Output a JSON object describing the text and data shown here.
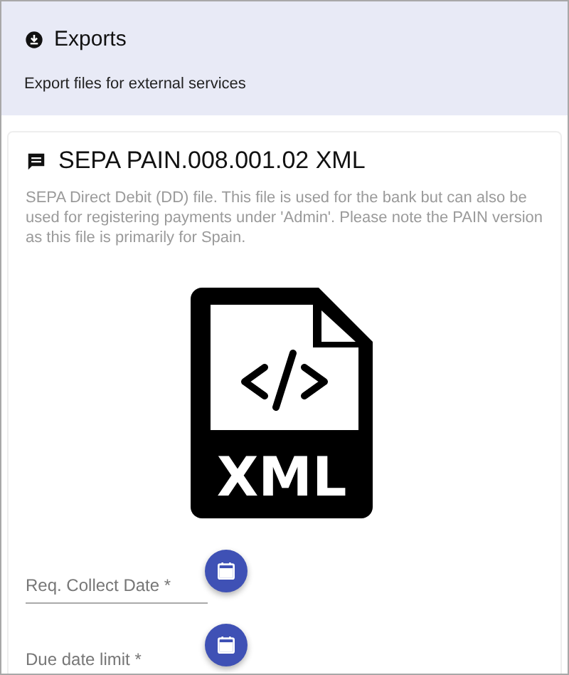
{
  "header": {
    "title": "Exports",
    "subtitle": "Export files for external services"
  },
  "card": {
    "title": "SEPA PAIN.008.001.02 XML",
    "description": "SEPA Direct Debit (DD) file. This file is used for the bank but can also be used for registering payments under 'Admin'. Please note the PAIN version as this file is primarily for Spain.",
    "file_icon_label": "XML",
    "fields": [
      {
        "placeholder": "Req. Collect Date *"
      },
      {
        "placeholder": "Due date limit *"
      }
    ]
  }
}
